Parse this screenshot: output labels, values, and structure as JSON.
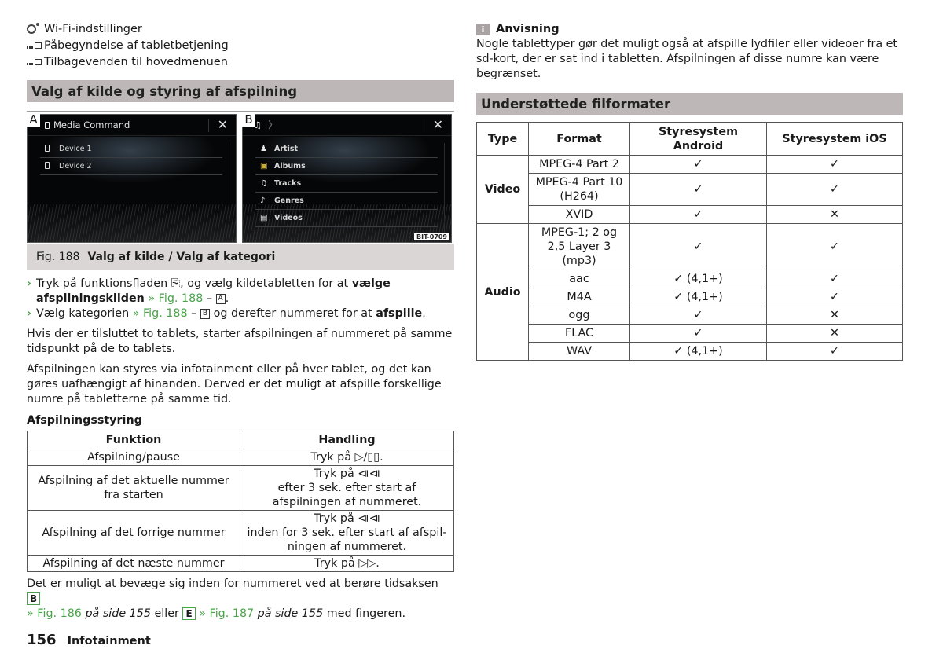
{
  "left": {
    "icon_list": [
      {
        "icon": "wifi-settings-icon",
        "label": "Wi-Fi-indstillinger"
      },
      {
        "icon": "tablet-control-icon",
        "label": "Påbegyndelse af tabletbetjening"
      },
      {
        "icon": "tablet-control-icon",
        "label": "Tilbagevenden til hovedmenuen"
      }
    ],
    "section_title": "Valg af kilde og styring af afspilning",
    "figure": {
      "screen_a": {
        "letter": "A",
        "title": "Media Command",
        "close": "✕",
        "items": [
          {
            "icon": "phone-icon",
            "label": "Device 1"
          },
          {
            "icon": "phone-icon",
            "label": "Device 2"
          }
        ]
      },
      "screen_b": {
        "letter": "B",
        "breadcrumb_icon": "♫",
        "breadcrumb_sep": "〉",
        "close": "✕",
        "items": [
          {
            "icon": "artist-icon",
            "glyph": "♟",
            "label": "Artist"
          },
          {
            "icon": "album-icon",
            "glyph": "▣",
            "label": "Albums"
          },
          {
            "icon": "music-note-icon",
            "glyph": "♫",
            "label": "Tracks"
          },
          {
            "icon": "guitar-icon",
            "glyph": "♪",
            "label": "Genres"
          },
          {
            "icon": "video-clapper-icon",
            "glyph": "▤",
            "label": "Videos"
          }
        ]
      },
      "code": "BIT-0709"
    },
    "caption": {
      "number": "Fig. 188",
      "text": "Valg af kilde / Valg af kategori"
    },
    "bullets": [
      {
        "pre": "Tryk på funktionsfladen ⎘, og vælg kildetabletten for at ",
        "bold": "vælge afspilnings­kilden",
        "ref": " » Fig. 188",
        "dash": " – ",
        "box": "A",
        "post": "."
      },
      {
        "pre": "Vælg kategorien",
        "ref": " » Fig. 188",
        "dash": " – ",
        "box": "B",
        "post": " og derefter nummeret for at ",
        "bold": "afspille",
        "end": "."
      }
    ],
    "para1": "Hvis der er tilsluttet to tablets, starter afspilningen af nummeret på samme tidspunkt på de to tablets.",
    "para2": "Afspilningen kan styres via infotainment eller på hver tablet, og det kan gøres uafhængigt af hinanden. Derved er det muligt at afspille forskellige numre på tabletterne på samme tid.",
    "table_title": "Afspilningsstyring",
    "control_table": {
      "headers": [
        "Funktion",
        "Handling"
      ],
      "rows": [
        [
          "Afspilning/pause",
          "Tryk på ▷/▯▯."
        ],
        [
          "Afspilning af det aktuelle nummer fra starten",
          "Tryk på ⧏⧏\nefter 3 sek. efter start af afspilningen af nummeret."
        ],
        [
          "Afspilning af det forrige nummer",
          "Tryk på ⧏⧏\ninden for 3 sek. efter start af afspil­ningen af nummeret."
        ],
        [
          "Afspilning af det næste nummer",
          "Tryk på ▷▷."
        ]
      ]
    },
    "final_para": {
      "pre": "Det er muligt at bevæge sig inden for nummeret ved at berøre tidsaksen ",
      "box1": "B",
      "ref1": " » Fig. 186",
      "ital1": " på side 155",
      "mid": " eller ",
      "box2": "E",
      "ref2": " » Fig. 187",
      "ital2": " på side 155",
      "post": " med fingeren."
    }
  },
  "footer": {
    "page": "156",
    "chapter": "Infotainment"
  },
  "right": {
    "note": {
      "icon": "i",
      "title": "Anvisning",
      "body": "Nogle tablettyper gør det muligt også at afspille lydfiler eller videoer fra et sd-kort, der er sat ind i tabletten. Afspilningen af disse numre kan være begræn­set."
    },
    "section_title": "Understøttede filformater",
    "format_table": {
      "headers": [
        "Type",
        "Format",
        "Styresystem Android",
        "Styresystem iOS"
      ],
      "groups": [
        {
          "type": "Video",
          "rows": [
            [
              "MPEG-4 Part 2",
              "✓",
              "✓"
            ],
            [
              "MPEG-4 Part 10 (H264)",
              "✓",
              "✓"
            ],
            [
              "XVID",
              "✓",
              "✕"
            ]
          ]
        },
        {
          "type": "Audio",
          "rows": [
            [
              "MPEG-1; 2 og 2,5 Layer 3 (mp3)",
              "✓",
              "✓"
            ],
            [
              "aac",
              "✓ (4,1+)",
              "✓"
            ],
            [
              "M4A",
              "✓ (4,1+)",
              "✓"
            ],
            [
              "ogg",
              "✓",
              "✕"
            ],
            [
              "FLAC",
              "✓",
              "✕"
            ],
            [
              "WAV",
              "✓ (4,1+)",
              "✓"
            ]
          ]
        }
      ]
    }
  }
}
